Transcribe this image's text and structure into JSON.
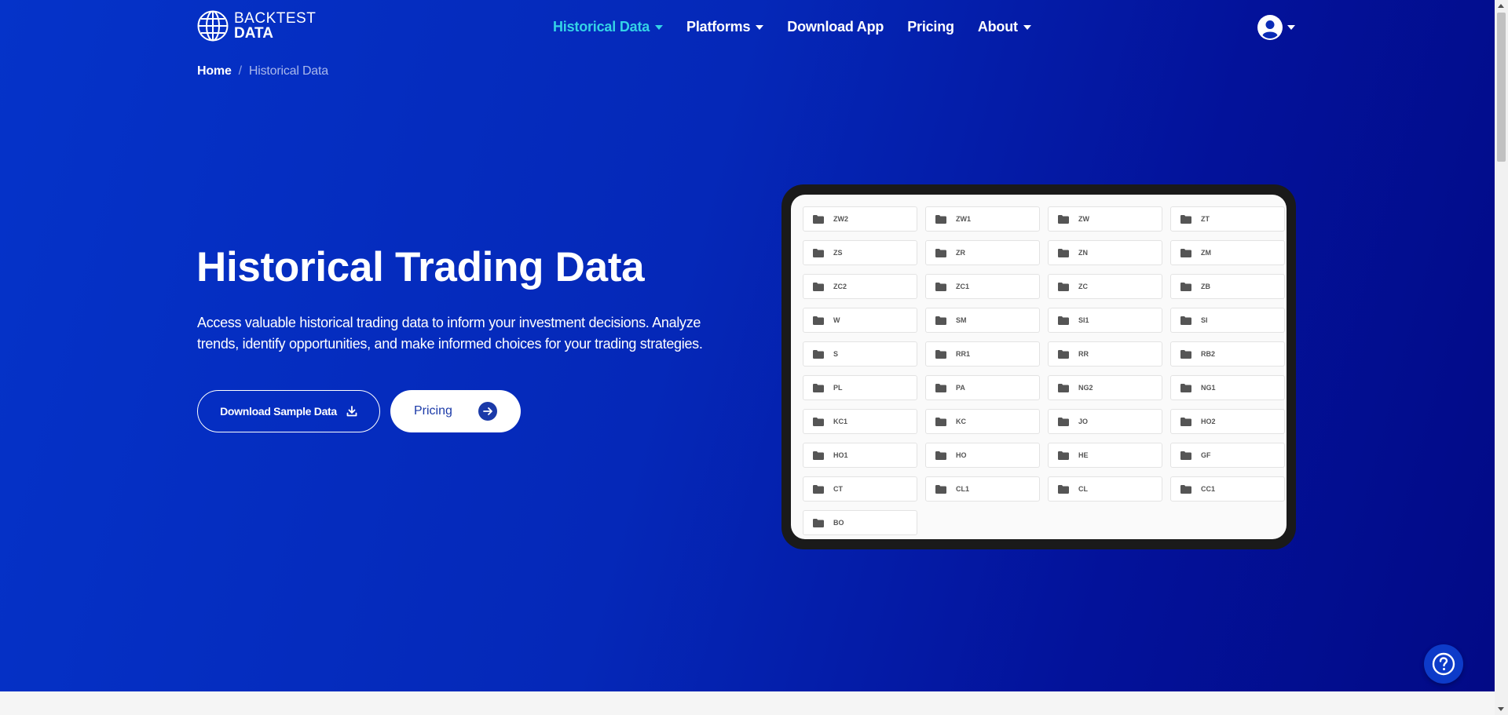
{
  "brand": {
    "line1": "BACKTEST",
    "line2": "DATA"
  },
  "nav": {
    "items": [
      {
        "label": "Historical Data",
        "dropdown": true,
        "active": true
      },
      {
        "label": "Platforms",
        "dropdown": true
      },
      {
        "label": "Download App"
      },
      {
        "label": "Pricing"
      },
      {
        "label": "About",
        "dropdown": true
      }
    ]
  },
  "breadcrumb": {
    "home": "Home",
    "separator": "/",
    "current": "Historical Data"
  },
  "hero": {
    "title": "Historical Trading Data",
    "description": "Access valuable historical trading data to inform your investment decisions. Analyze trends, identify opportunities, and make informed choices for your trading strategies.",
    "download_button": "Download Sample Data",
    "pricing_button": "Pricing"
  },
  "folders": [
    "ZW2",
    "ZW1",
    "ZW",
    "ZT",
    "ZS",
    "ZR",
    "ZN",
    "ZM",
    "ZC2",
    "ZC1",
    "ZC",
    "ZB",
    "W",
    "SM",
    "SI1",
    "SI",
    "S",
    "RR1",
    "RR",
    "RB2",
    "PL",
    "PA",
    "NG2",
    "NG1",
    "KC1",
    "KC",
    "JO",
    "HO2",
    "HO1",
    "HO",
    "HE",
    "GF",
    "CT",
    "CL1",
    "CL",
    "CC1",
    "BO"
  ],
  "colors": {
    "accent": "#34d3e6",
    "hero_start": "#0533c9",
    "hero_end": "#020a86",
    "button_text": "#1b3aa8"
  },
  "icons": {
    "logo": "globe-icon",
    "user": "user-circle-icon",
    "download": "download-icon",
    "arrow": "arrow-right-icon",
    "folder": "folder-icon",
    "help": "question-icon"
  }
}
